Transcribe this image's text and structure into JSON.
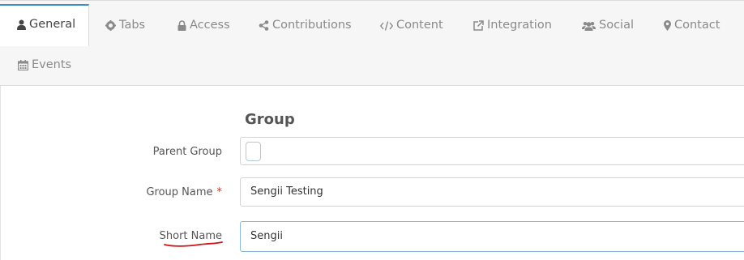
{
  "tabs": [
    {
      "label": "General",
      "icon": "user-icon",
      "active": true
    },
    {
      "label": "Tabs",
      "icon": "gear-icon"
    },
    {
      "label": "Access",
      "icon": "lock-icon"
    },
    {
      "label": "Contributions",
      "icon": "share-icon"
    },
    {
      "label": "Content",
      "icon": "code-icon"
    },
    {
      "label": "Integration",
      "icon": "external-link-icon"
    },
    {
      "label": "Social",
      "icon": "users-icon"
    },
    {
      "label": "Contact",
      "icon": "map-marker-icon"
    },
    {
      "label": "Events",
      "icon": "calendar-icon"
    }
  ],
  "form": {
    "section_title": "Group",
    "parent_group": {
      "label": "Parent Group",
      "value": ""
    },
    "group_name": {
      "label": "Group Name",
      "required_mark": "*",
      "value": "Sengii Testing"
    },
    "short_name": {
      "label": "Short Name",
      "value": "Sengii"
    }
  },
  "colors": {
    "accent": "#3a8ccd",
    "required": "#c0392b",
    "annotation": "#d0141a"
  }
}
